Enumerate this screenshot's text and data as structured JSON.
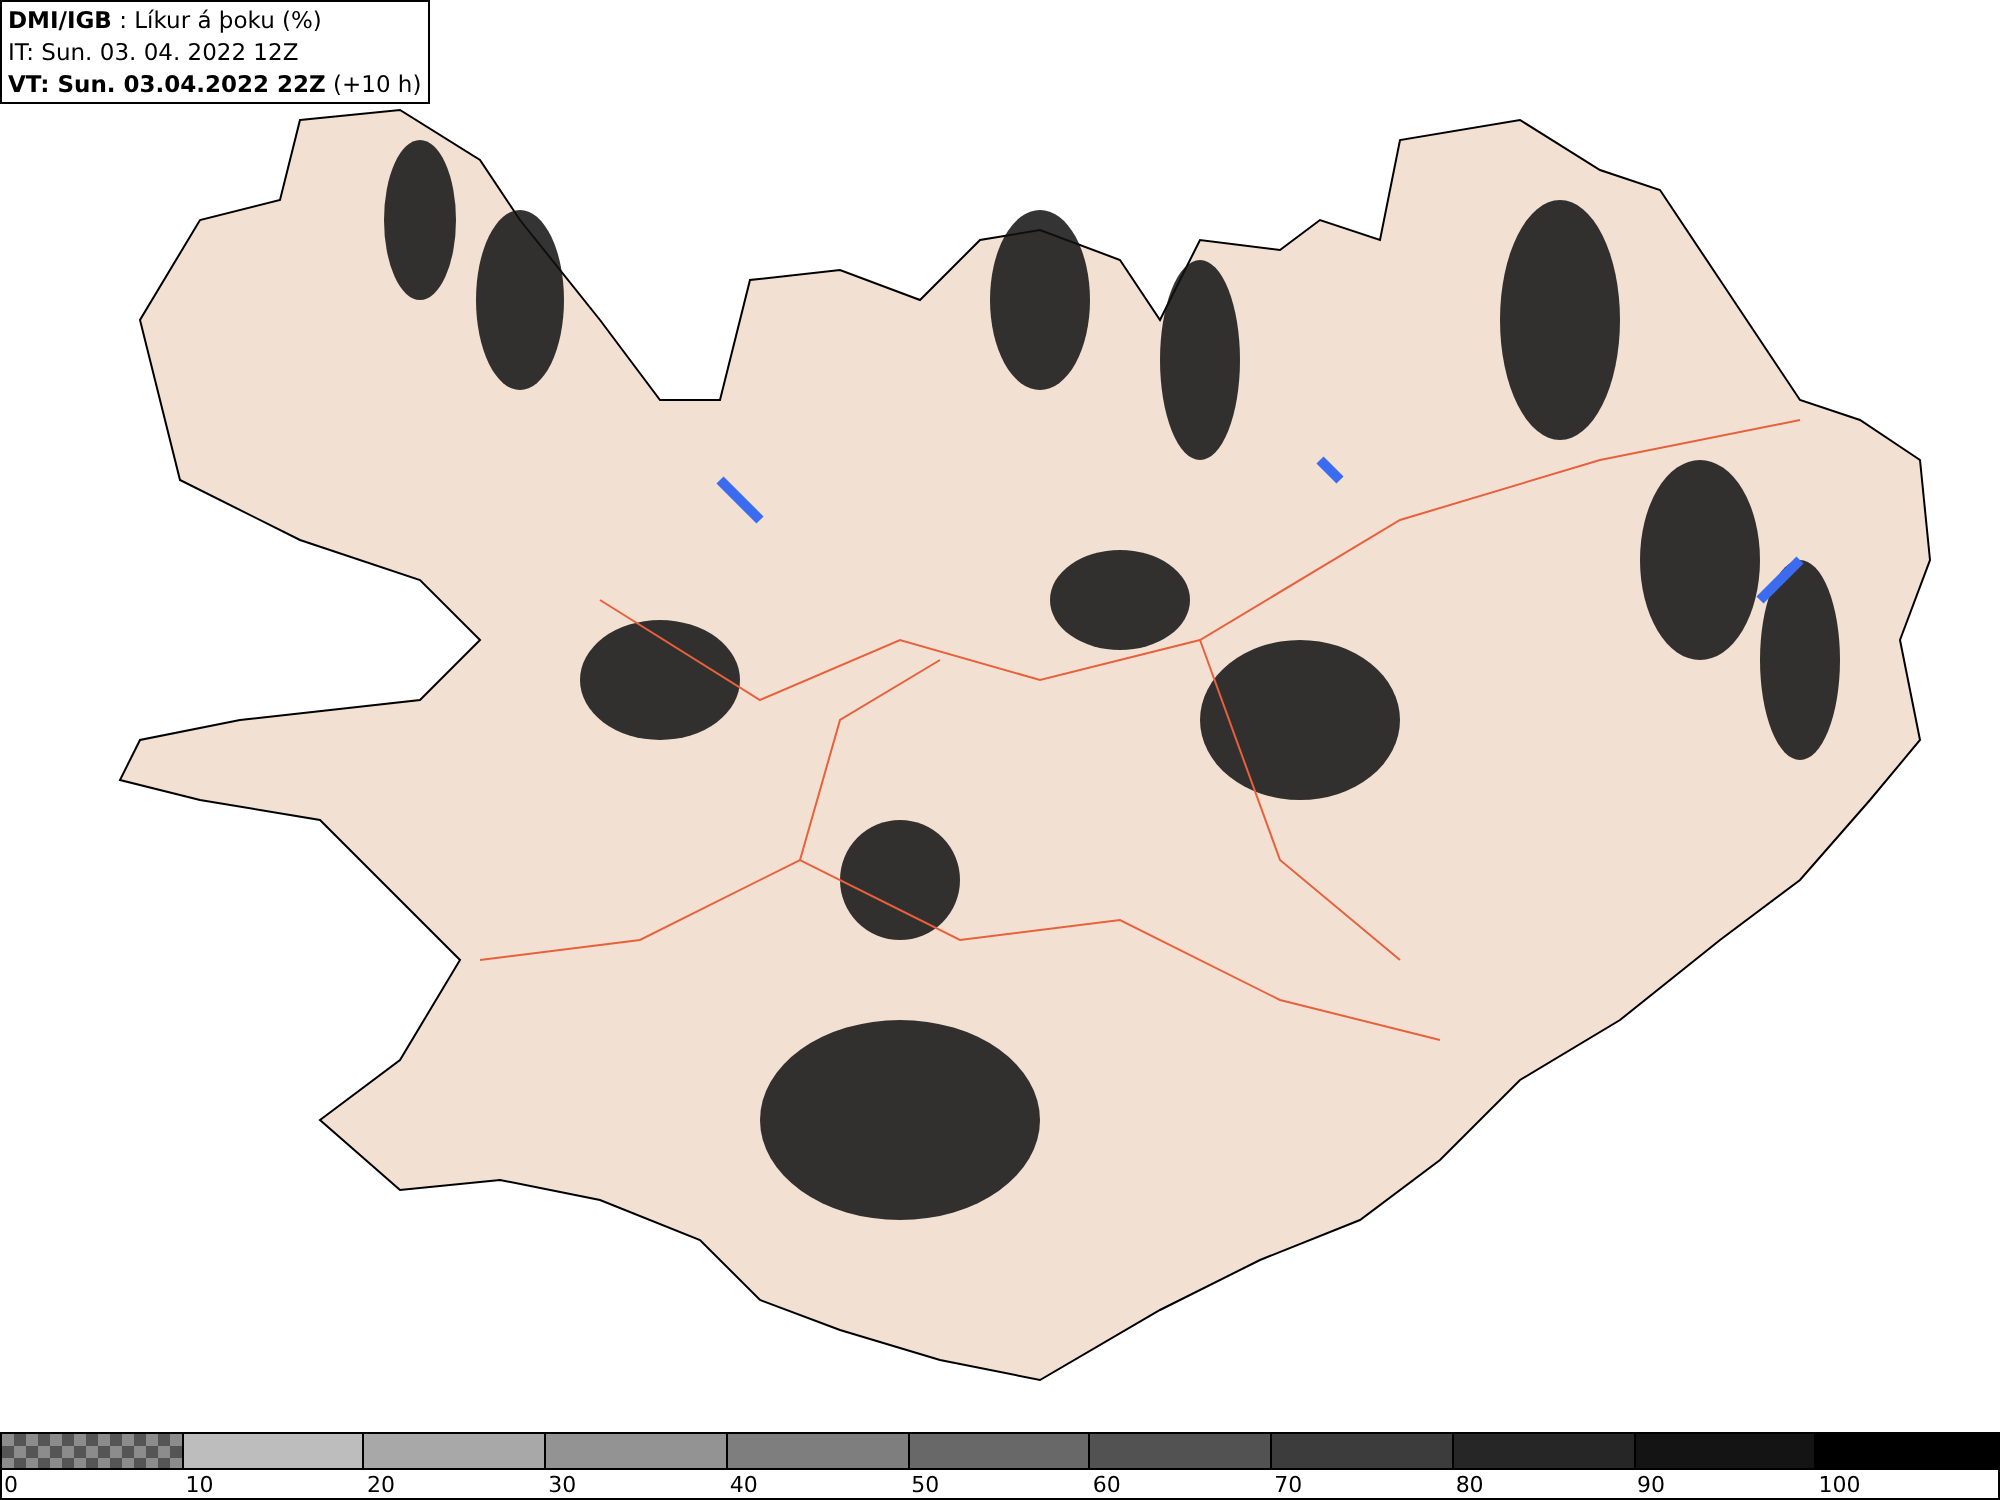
{
  "header": {
    "lines": [
      "**DMI/IGB** : Líkur á þoku (%)",
      "IT: Sun. 03. 04. 2022 12Z",
      "**VT: Sun. 03.04.2022 22Z** (+10 h)"
    ]
  },
  "legend": [
    {
      "label": "0",
      "kind": "checker",
      "color": "#8c8c8c"
    },
    {
      "label": "10",
      "kind": "solid",
      "color": "#bdbdbd"
    },
    {
      "label": "20",
      "kind": "solid",
      "color": "#a8a8a8"
    },
    {
      "label": "30",
      "kind": "solid",
      "color": "#939393"
    },
    {
      "label": "40",
      "kind": "solid",
      "color": "#7e7e7e"
    },
    {
      "label": "50",
      "kind": "solid",
      "color": "#686868"
    },
    {
      "label": "60",
      "kind": "solid",
      "color": "#525252"
    },
    {
      "label": "70",
      "kind": "solid",
      "color": "#3c3c3c"
    },
    {
      "label": "80",
      "kind": "solid",
      "color": "#262626"
    },
    {
      "label": "90",
      "kind": "solid",
      "color": "#141414"
    },
    {
      "label": "100",
      "kind": "solid",
      "color": "#000000"
    }
  ]
}
